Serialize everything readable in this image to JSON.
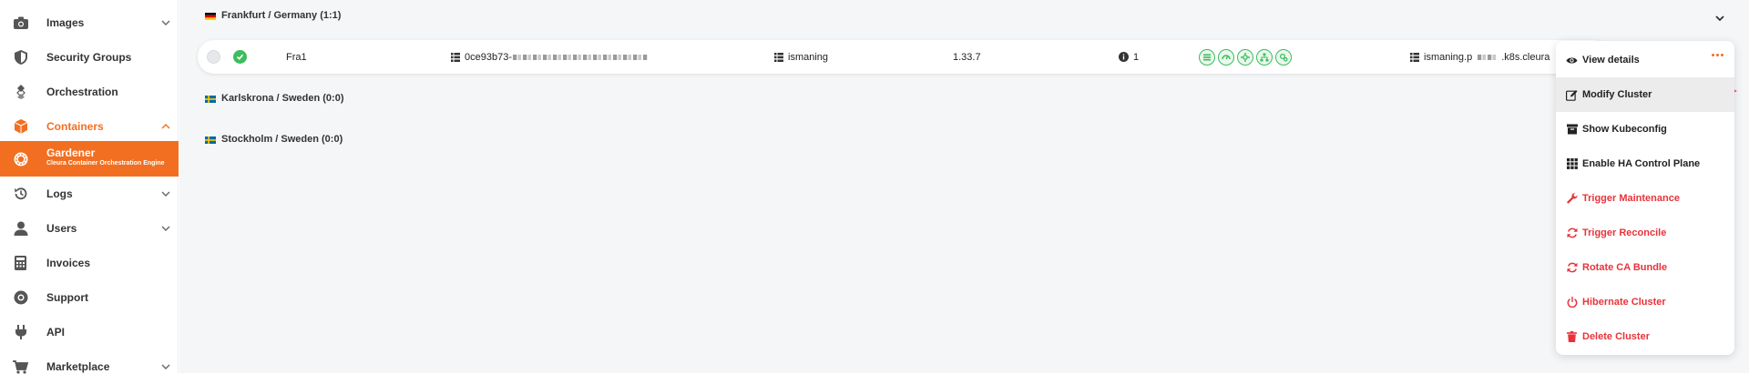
{
  "sidebar": {
    "items": [
      {
        "label": "Images",
        "icon": "camera-icon",
        "chevron": "down"
      },
      {
        "label": "Security Groups",
        "icon": "shield-icon",
        "chevron": ""
      },
      {
        "label": "Orchestration",
        "icon": "orchestration-icon",
        "chevron": ""
      },
      {
        "label": "Containers",
        "icon": "cube-icon",
        "chevron": "up"
      },
      {
        "label": "Gardener",
        "sublabel": "Cleura Container Orchestration Engine",
        "icon": "gardener-icon"
      },
      {
        "label": "Logs",
        "icon": "history-icon",
        "chevron": "down"
      },
      {
        "label": "Users",
        "icon": "user-icon",
        "chevron": "down"
      },
      {
        "label": "Invoices",
        "icon": "calculator-icon",
        "chevron": ""
      },
      {
        "label": "Support",
        "icon": "lifebuoy-icon",
        "chevron": ""
      },
      {
        "label": "API",
        "icon": "plug-icon",
        "chevron": ""
      },
      {
        "label": "Marketplace",
        "icon": "cart-icon",
        "chevron": "down"
      }
    ]
  },
  "regions": [
    {
      "label": "Frankfurt / Germany (1:1)",
      "flag": "germany"
    },
    {
      "label": "Karlskrona / Sweden (0:0)",
      "flag": "sweden"
    },
    {
      "label": "Stockholm / Sweden (0:0)",
      "flag": "sweden"
    }
  ],
  "cluster": {
    "name": "Fra1",
    "id_prefix": "0ce93b73-",
    "project": "ismaning",
    "version": "1.33.7",
    "info_count": "1",
    "endpoint_prefix": "ismaning.p",
    "endpoint_suffix": ".k8s.cleura"
  },
  "menu": {
    "items": [
      {
        "label": "View details",
        "icon": "eye-icon"
      },
      {
        "label": "Modify Cluster",
        "icon": "edit-icon"
      },
      {
        "label": "Show Kubeconfig",
        "icon": "archive-icon"
      },
      {
        "label": "Enable HA Control Plane",
        "icon": "grid-icon"
      },
      {
        "label": "Trigger Maintenance",
        "icon": "wrench-icon"
      },
      {
        "label": "Trigger Reconcile",
        "icon": "refresh-icon"
      },
      {
        "label": "Rotate CA Bundle",
        "icon": "refresh-icon"
      },
      {
        "label": "Hibernate Cluster",
        "icon": "power-icon"
      },
      {
        "label": "Delete Cluster",
        "icon": "trash-icon"
      }
    ]
  },
  "colors": {
    "accent": "#f26f21",
    "danger": "#e8333a",
    "ok": "#3dbd5d",
    "annotation_arrow": "#ea4f8c"
  }
}
